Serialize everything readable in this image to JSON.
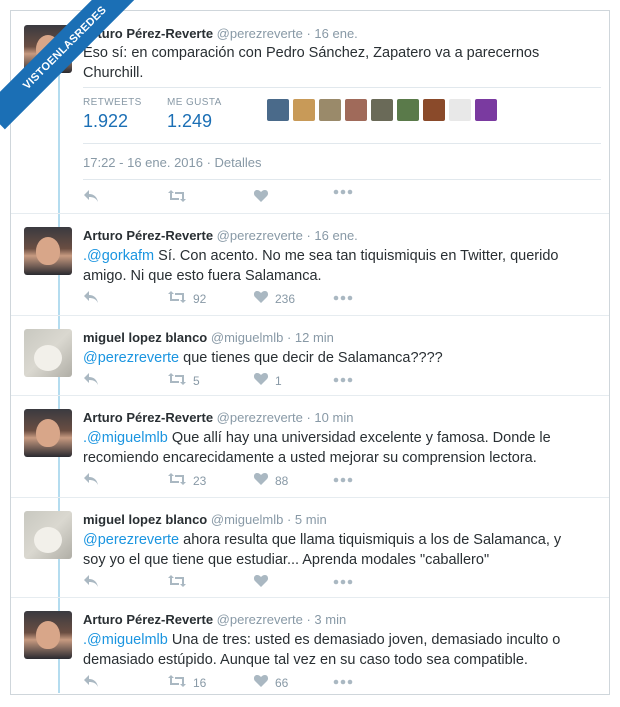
{
  "watermark": "VISTOENLASREDES",
  "main_tweet": {
    "name": "Arturo Pérez-Reverte",
    "handle": "@perezreverte",
    "time": "· 16 ene.",
    "text": "Eso sí: en comparación con Pedro Sánchez, Zapatero va a parecernos Churchill.",
    "retweets_label": "RETWEETS",
    "retweets_value": "1.922",
    "likes_label": "ME GUSTA",
    "likes_value": "1.249",
    "dateline": "17:22 - 16 ene. 2016 · Detalles",
    "face_colors": [
      "#4a6a8a",
      "#c89a58",
      "#9a8a6a",
      "#a06a5a",
      "#6a6a58",
      "#5a7a4a",
      "#8a4a2a",
      "#e8e8e8",
      "#7a3aa0"
    ]
  },
  "replies": [
    {
      "name": "Arturo Pérez-Reverte",
      "handle": "@perezreverte",
      "time": "· 16 ene.",
      "mention": ".@gorkafm",
      "text": " Sí. Con acento. No me sea tan tiquismiquis en Twitter, querido amigo. Ni que esto fuera Salamanca.",
      "retweets": "92",
      "likes": "236"
    },
    {
      "name": "miguel lopez blanco",
      "handle": "@miguelmlb",
      "time": "· 12 min",
      "mention": "@perezreverte",
      "text": " que tienes que decir de Salamanca????",
      "retweets": "5",
      "likes": "1"
    },
    {
      "name": "Arturo Pérez-Reverte",
      "handle": "@perezreverte",
      "time": "· 10 min",
      "mention": ".@miguelmlb",
      "text": " Que allí hay una universidad excelente y famosa. Donde le recomiendo encarecidamente a usted mejorar su comprension lectora.",
      "retweets": "23",
      "likes": "88"
    },
    {
      "name": "miguel lopez blanco",
      "handle": "@miguelmlb",
      "time": "· 5 min",
      "mention": "@perezreverte",
      "text": " ahora resulta que llama tiquismiquis a los de Salamanca, y soy yo el que tiene que estudiar... Aprenda modales \"caballero\"",
      "retweets": "",
      "likes": ""
    },
    {
      "name": "Arturo Pérez-Reverte",
      "handle": "@perezreverte",
      "time": "· 3 min",
      "mention": ".@miguelmlb",
      "text": " Una de tres: usted es demasiado joven, demasiado inculto o demasiado estúpido. Aunque tal vez en su caso todo sea compatible.",
      "retweets": "16",
      "likes": "66"
    }
  ],
  "icons": [
    "reply-icon",
    "retweet-icon",
    "heart-icon",
    "more-icon"
  ],
  "colors": {
    "link": "#1b95e0",
    "stat": "#1b6fb5",
    "muted": "#8899a6",
    "icon": "#aab8c2"
  }
}
